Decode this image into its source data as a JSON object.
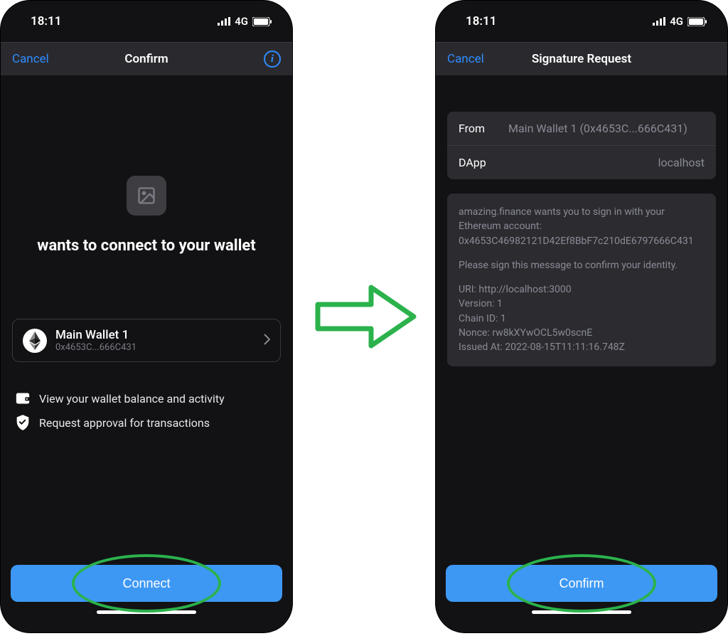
{
  "status": {
    "time": "18:11",
    "network": "4G"
  },
  "left": {
    "nav": {
      "cancel": "Cancel",
      "title": "Confirm"
    },
    "heading": "wants to connect to your wallet",
    "wallet": {
      "name": "Main Wallet 1",
      "address": "0x4653C...666C431"
    },
    "permissions": {
      "balance": "View your wallet balance and activity",
      "approval": "Request approval for transactions"
    },
    "button": "Connect"
  },
  "right": {
    "nav": {
      "cancel": "Cancel",
      "title": "Signature Request"
    },
    "info": {
      "from_label": "From",
      "from_value": "Main Wallet 1 (0x4653C...666C431)",
      "dapp_label": "DApp",
      "dapp_value": "localhost"
    },
    "message": {
      "intro": "amazing.finance wants you to sign in with your Ethereum account:",
      "account": "0x4653C46982121D42Ef8BbF7c210dE6797666C431",
      "prompt": "Please sign this message to confirm your identity.",
      "uri": "URI: http://localhost:3000",
      "version": "Version: 1",
      "chain": "Chain ID: 1",
      "nonce": "Nonce: rw8kXYwOCL5w0scnE",
      "issued": "Issued At: 2022-08-15T11:11:16.748Z"
    },
    "button": "Confirm"
  }
}
